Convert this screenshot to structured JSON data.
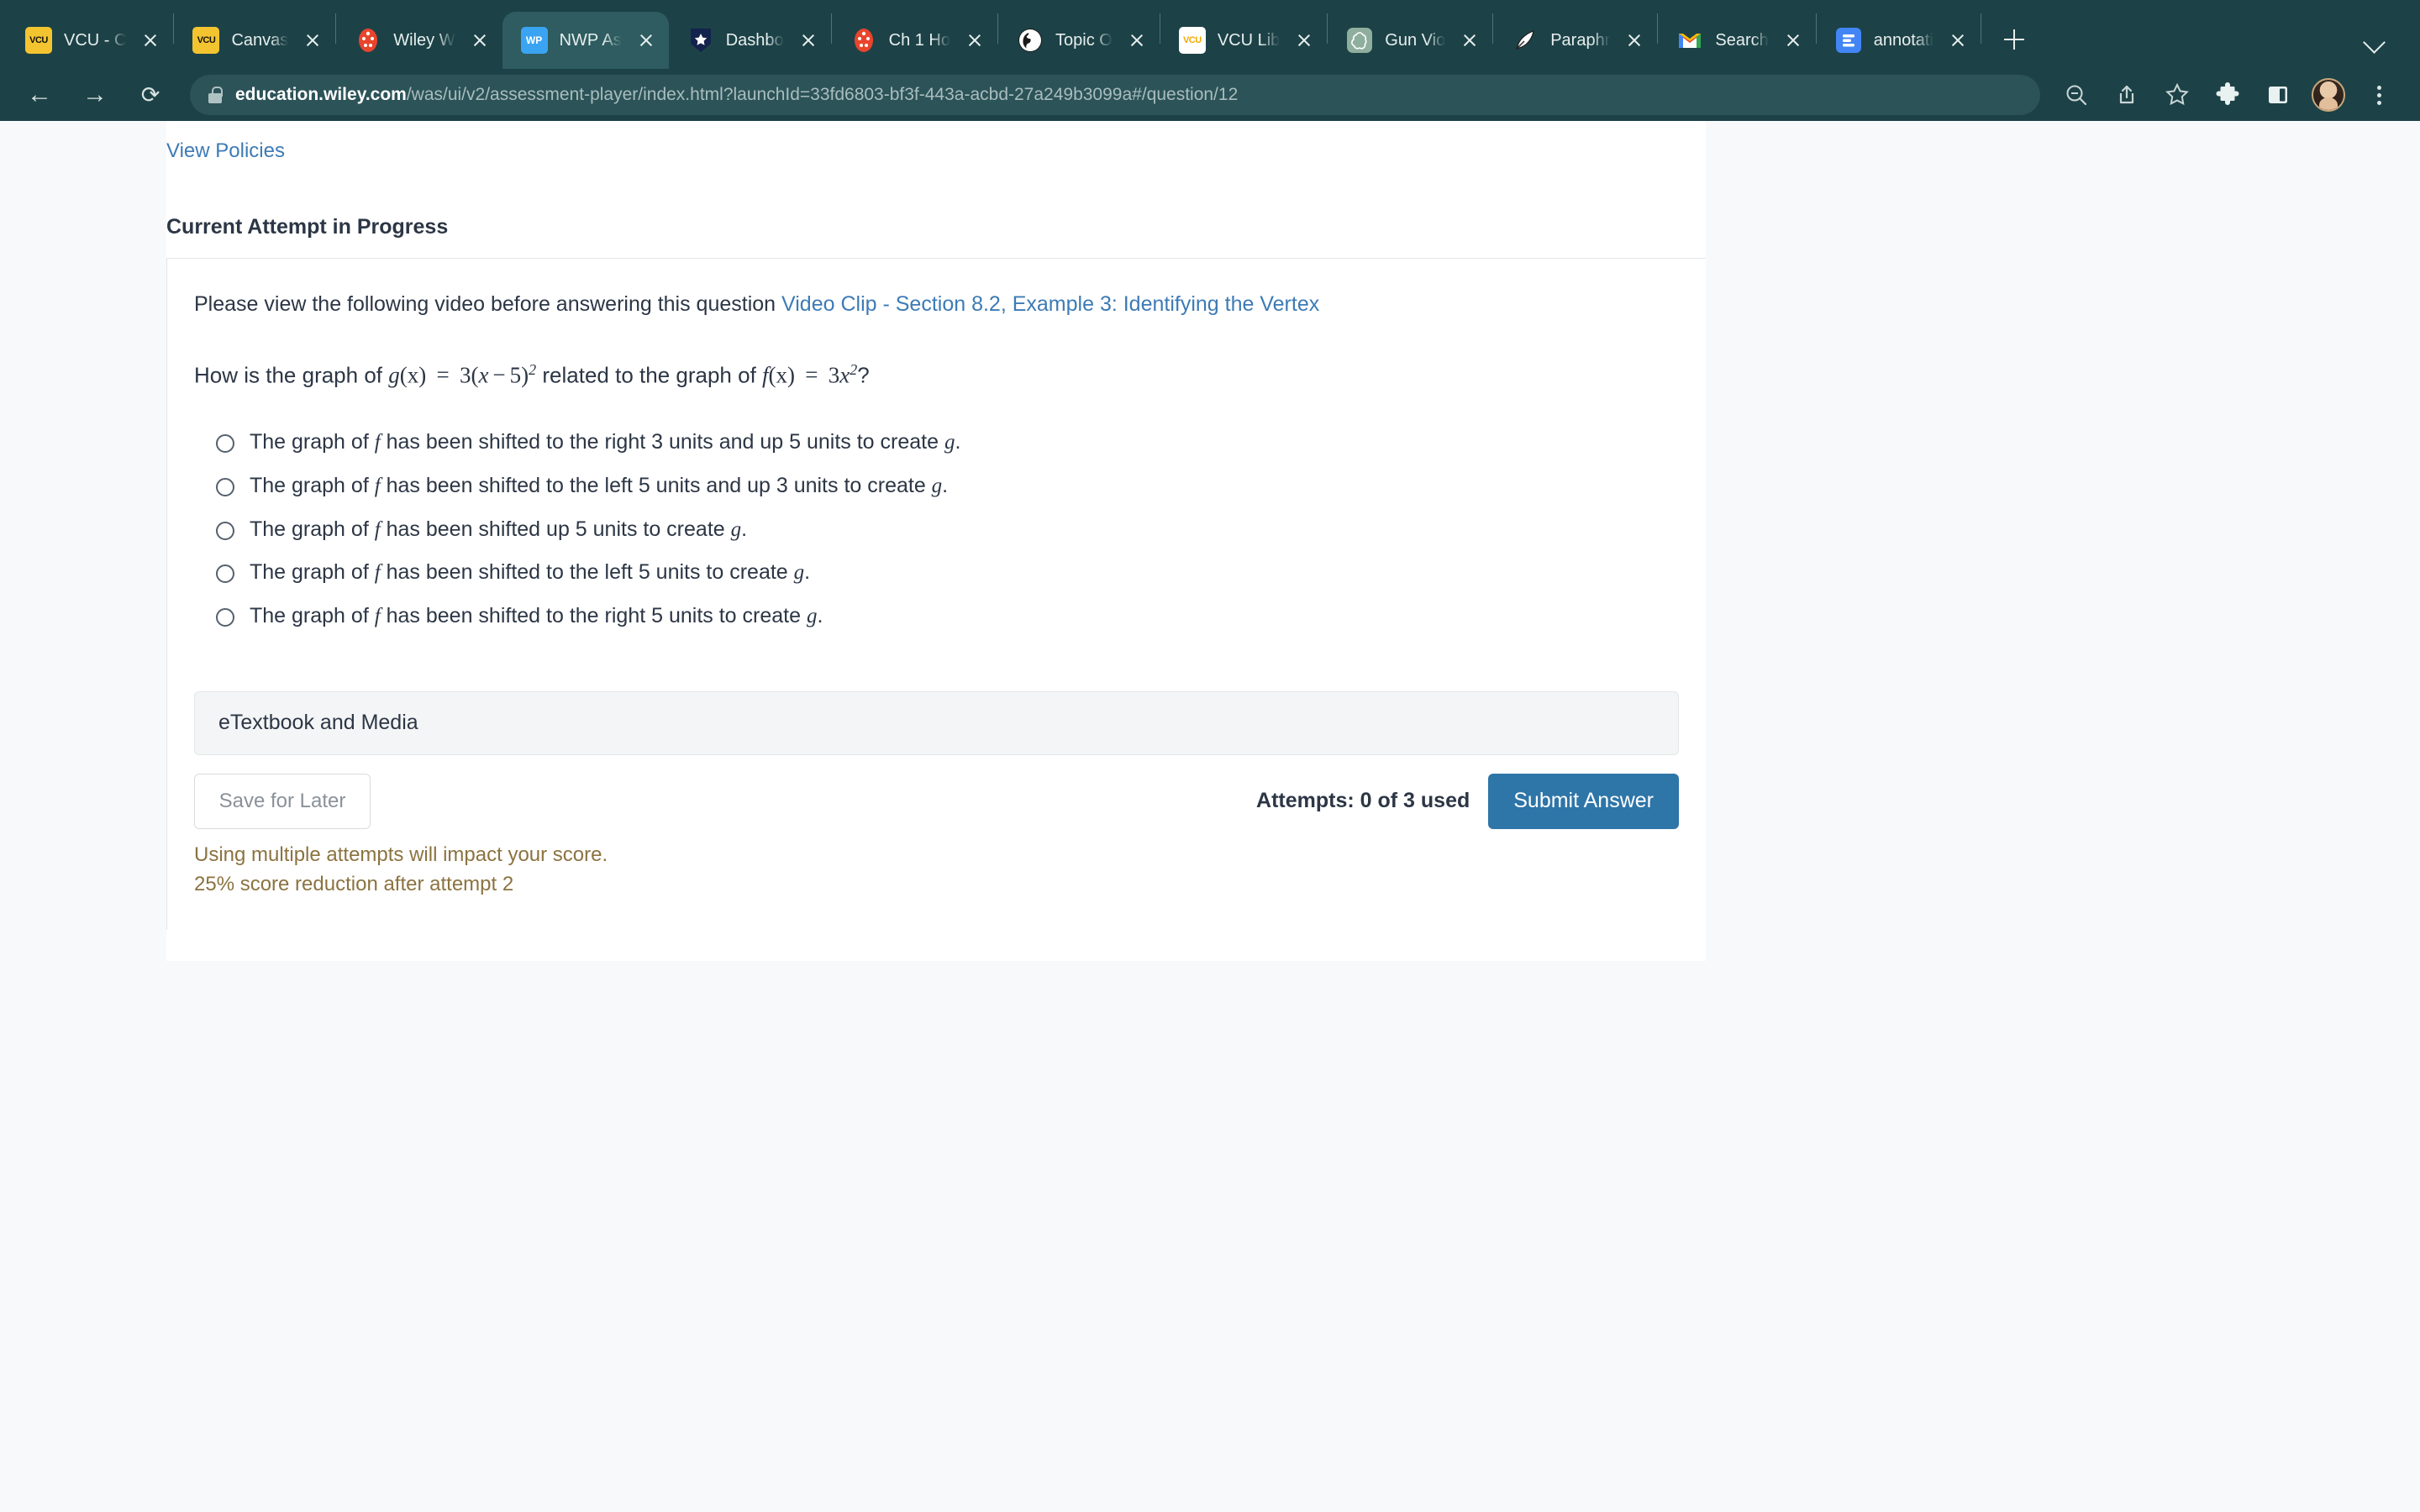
{
  "browser": {
    "tabs": [
      {
        "title": "VCU - C",
        "favicon": "vcu-icon",
        "active": false
      },
      {
        "title": "Canvas",
        "favicon": "canvas-icon",
        "active": false
      },
      {
        "title": "Wiley W",
        "favicon": "canvas-red-icon",
        "active": false
      },
      {
        "title": "NWP As",
        "favicon": "wileyplus-icon",
        "active": true
      },
      {
        "title": "Dashbo",
        "favicon": "star-shield-icon",
        "active": false
      },
      {
        "title": "Ch 1 Ho",
        "favicon": "canvas-red-icon",
        "active": false
      },
      {
        "title": "Topic O",
        "favicon": "globe-icon",
        "active": false
      },
      {
        "title": "VCU Lib",
        "favicon": "vcu-white-icon",
        "active": false
      },
      {
        "title": "Gun Vio",
        "favicon": "openai-icon",
        "active": false
      },
      {
        "title": "Paraphr",
        "favicon": "quill-icon",
        "active": false
      },
      {
        "title": "Search",
        "favicon": "gmail-icon",
        "active": false
      },
      {
        "title": "annotati",
        "favicon": "document-icon",
        "active": false
      }
    ],
    "new_tab_label": "+",
    "url_host": "education.wiley.com",
    "url_path": "/was/ui/v2/assessment-player/index.html?launchId=33fd6803-bf3f-443a-acbd-27a249b3099a#/question/12",
    "url_full": "education.wiley.com/was/ui/v2/assessment-player/index.html?launchId=33fd6803-bf3f-443a-acbd-27a249b3099a#/question/12",
    "toolbar_icons": [
      "zoom-out-icon",
      "share-icon",
      "bookmark-star-icon",
      "extensions-puzzle-icon",
      "side-panel-icon",
      "profile-avatar",
      "chrome-menu-kebab-icon"
    ],
    "chrome_bg": "#1C4247",
    "active_tab_bg": "#2E5C60"
  },
  "page": {
    "view_policies_link": "View Policies",
    "attempt_heading": "Current Attempt in Progress",
    "video_prompt": "Please view the following video before answering this question",
    "video_link": "Video Clip - Section 8.2, Example 3: Identifying the Vertex",
    "question": {
      "lead": "How is the graph of",
      "g_name": "g",
      "g_arg": "(x)",
      "equals": "=",
      "g_coefficient": "3",
      "g_open": "(",
      "g_var": "x",
      "g_minus": "−",
      "g_shift": "5",
      "g_close": ")",
      "g_exponent": "2",
      "middle": "related to the graph of",
      "f_name": "f",
      "f_arg": "(x)",
      "f_coefficient": "3",
      "f_var": "x",
      "f_exponent": "2",
      "trailing": "?",
      "plain_text": "How is the graph of g(x) = 3(x − 5)² related to the graph of f(x) = 3x²?"
    },
    "options": [
      {
        "prefix": "The graph of ",
        "var1": "f",
        "mid": " has been shifted to the right 3 units and up 5 units to create ",
        "var2": "g",
        "suffix": ".",
        "selected": false
      },
      {
        "prefix": "The graph of ",
        "var1": "f",
        "mid": " has been shifted to the left 5 units and up 3 units to create ",
        "var2": "g",
        "suffix": ".",
        "selected": false
      },
      {
        "prefix": "The graph of ",
        "var1": "f",
        "mid": " has been shifted up 5 units to create ",
        "var2": "g",
        "suffix": ".",
        "selected": false
      },
      {
        "prefix": "The graph of ",
        "var1": "f",
        "mid": " has been shifted to the left 5 units to create ",
        "var2": "g",
        "suffix": ".",
        "selected": false
      },
      {
        "prefix": "The graph of ",
        "var1": "f",
        "mid": " has been shifted to the right 5 units to create ",
        "var2": "g",
        "suffix": ".",
        "selected": false
      }
    ],
    "etextbook_label": "eTextbook and Media",
    "save_for_later_label": "Save for Later",
    "attempts_text": "Attempts: 0 of 3 used",
    "submit_label": "Submit Answer",
    "warning_line_1": "Using multiple attempts will impact your score.",
    "warning_line_2": "25% score reduction after attempt 2",
    "colors": {
      "link": "#3D7BB5",
      "submit_button": "#2E75A8",
      "warning_text": "#8B7340",
      "body_text": "#2C3645",
      "page_bg": "#F8F9FA"
    }
  }
}
